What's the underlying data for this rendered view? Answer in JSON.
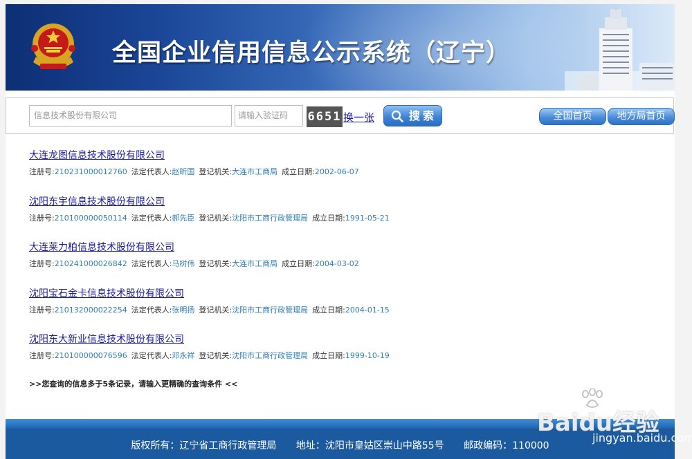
{
  "header": {
    "title": "全国企业信用信息公示系统（辽宁）",
    "emblem_icon": "national-emblem-icon",
    "building_icon": "building-icon"
  },
  "search": {
    "keyword_value": "信息技术股份有限公司",
    "captcha_placeholder": "请输入验证码",
    "captcha_code": "6651",
    "refresh_label": "换一张",
    "search_label": "搜索",
    "national_home_label": "全国首页",
    "local_home_label": "地方局首页"
  },
  "labels": {
    "reg_no": "注册号:",
    "legal_rep": "法定代表人:",
    "authority": "登记机关:",
    "founded": "成立日期:"
  },
  "results": [
    {
      "name": "大连龙图信息技术股份有限公司",
      "reg_no": "210231000012760",
      "legal_rep": "赵昕国",
      "authority": "大连市工商局",
      "founded": "2002-06-07"
    },
    {
      "name": "沈阳东宇信息技术股份有限公司",
      "reg_no": "210100000050114",
      "legal_rep": "郝先臣",
      "authority": "沈阳市工商行政管理局",
      "founded": "1991-05-21"
    },
    {
      "name": "大连莱力柏信息技术股份有限公司",
      "reg_no": "210241000026842",
      "legal_rep": "马树伟",
      "authority": "大连市工商局",
      "founded": "2004-03-02"
    },
    {
      "name": "沈阳宝石金卡信息技术股份有限公司",
      "reg_no": "210132000022254",
      "legal_rep": "张明扬",
      "authority": "沈阳市工商行政管理局",
      "founded": "2004-01-15"
    },
    {
      "name": "沈阳东大新业信息技术股份有限公司",
      "reg_no": "210100000076596",
      "legal_rep": "邓永祥",
      "authority": "沈阳市工商行政管理局",
      "founded": "1999-10-19"
    }
  ],
  "notice": ">>您查询的信息多于5条记录，请输入更精确的查询条件 <<",
  "footer": {
    "copyright": "版权所有：辽宁省工商行政管理局",
    "address": "地址：沈阳市皇姑区崇山中路55号",
    "postcode": "邮政编码：110000"
  },
  "watermark": {
    "brand": "Baidu经验",
    "url": "jingyan.baidu.com"
  },
  "colors": {
    "link": "#1b1b9a",
    "value": "#2f7fb6",
    "footer": "#1c5a9f"
  }
}
